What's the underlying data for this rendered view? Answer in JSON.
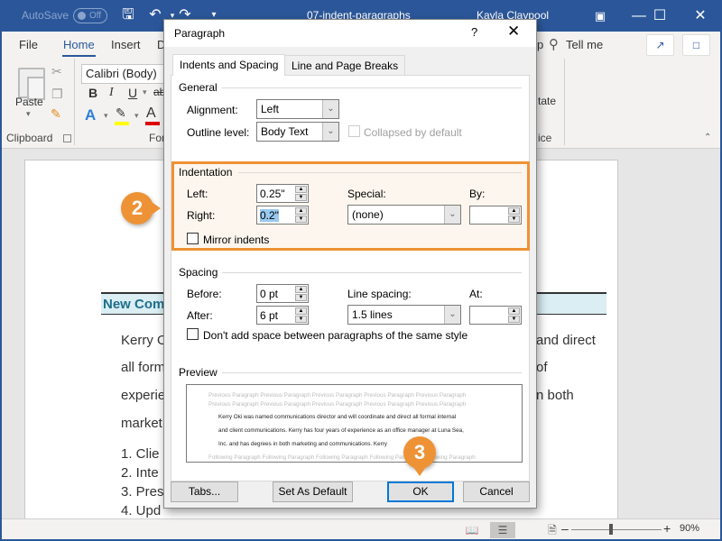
{
  "titlebar": {
    "autosave_label": "AutoSave",
    "autosave_state": "Off",
    "document_title": "07-indent-paragraphs",
    "user_name": "Kayla Claypool",
    "icons": [
      "save-icon",
      "undo-icon",
      "redo-icon",
      "customize-icon",
      "ribbon-display-icon",
      "minimize-icon",
      "maximize-icon",
      "close-icon"
    ]
  },
  "ribbon": {
    "tabs": [
      {
        "label": "File"
      },
      {
        "label": "Home",
        "active": true
      },
      {
        "label": "Insert"
      },
      {
        "label": "D"
      }
    ],
    "tell_me": "Tell me",
    "tell_me_fragment": "p",
    "clipboard": {
      "paste_label": "Paste",
      "group_label": "Clipboard"
    },
    "font": {
      "font_name": "Calibri (Body)",
      "group_label": "Fon",
      "bold": "B",
      "italic": "I",
      "underline": "U",
      "strike": "ab",
      "text_effects": "A",
      "font_color": "A",
      "highlight_color": "#ffff00",
      "font_color_swatch": "#e00000"
    },
    "right_fragments": {
      "dictate": "tate",
      "voice": "ice"
    },
    "partial_group_label": "D"
  },
  "document": {
    "heading": "New Comm",
    "lines": [
      {
        "left": "Kerry O",
        "right": "and direct"
      },
      {
        "left": "all form",
        "right": "of"
      },
      {
        "left": "experie",
        "right": "n both"
      },
      {
        "left": "market",
        "right": ""
      }
    ],
    "list": [
      "1.  Clie",
      "2.  Inte",
      "3.  Pres",
      "4.  Upd"
    ]
  },
  "statusbar": {
    "zoom_level": "90%",
    "zoom_value_percent": 90,
    "view_modes": [
      "read-mode",
      "print-layout",
      "web-layout"
    ],
    "active_view": "print-layout"
  },
  "dialog": {
    "title": "Paragraph",
    "help": "?",
    "tabs": [
      {
        "label": "Indents and Spacing",
        "active": true
      },
      {
        "label": "Line and Page Breaks",
        "active": false
      }
    ],
    "general": {
      "section_label": "General",
      "alignment_label": "Alignment:",
      "alignment_value": "Left",
      "outline_label": "Outline level:",
      "outline_value": "Body Text",
      "collapsed_label": "Collapsed by default",
      "collapsed_checked": false
    },
    "indentation": {
      "section_label": "Indentation",
      "left_label": "Left:",
      "left_value": "0.25\"",
      "right_label": "Right:",
      "right_value": "0.2\"",
      "special_label": "Special:",
      "special_value": "(none)",
      "by_label": "By:",
      "by_value": "",
      "mirror_label": "Mirror indents",
      "mirror_checked": false
    },
    "spacing": {
      "section_label": "Spacing",
      "before_label": "Before:",
      "before_value": "0 pt",
      "after_label": "After:",
      "after_value": "6 pt",
      "line_spacing_label": "Line spacing:",
      "line_spacing_value": "1.5 lines",
      "at_label": "At:",
      "at_value": "",
      "dont_add_label": "Don't add space between paragraphs of the same style",
      "dont_add_checked": false
    },
    "preview": {
      "section_label": "Preview",
      "previous_lines": [
        "Previous Paragraph Previous Paragraph Previous Paragraph Previous Paragraph Previous Paragraph",
        "Previous Paragraph Previous Paragraph Previous Paragraph Previous Paragraph Previous Paragraph"
      ],
      "current_lines": [
        "Kerry Oki was named communications director and will coordinate and direct all formal internal",
        "and client communications. Kerry has four years of experience as an office manager at Luna Sea,",
        "Inc. and has degrees in both marketing and communications. Kerry"
      ],
      "following_line": "Following Paragraph Following Paragraph Following Paragraph Following Paragraph Following Paragraph"
    },
    "buttons": {
      "tabs": "Tabs...",
      "set_default": "Set As Default",
      "ok": "OK",
      "cancel": "Cancel"
    }
  },
  "callouts": [
    {
      "number": "2",
      "target": "indentation-group"
    },
    {
      "number": "3",
      "target": "ok-button"
    }
  ],
  "colors": {
    "word_blue": "#2b579a",
    "callout_orange": "#ee9236",
    "ok_focus": "#0078d7",
    "heading_bg": "#daeef3"
  }
}
